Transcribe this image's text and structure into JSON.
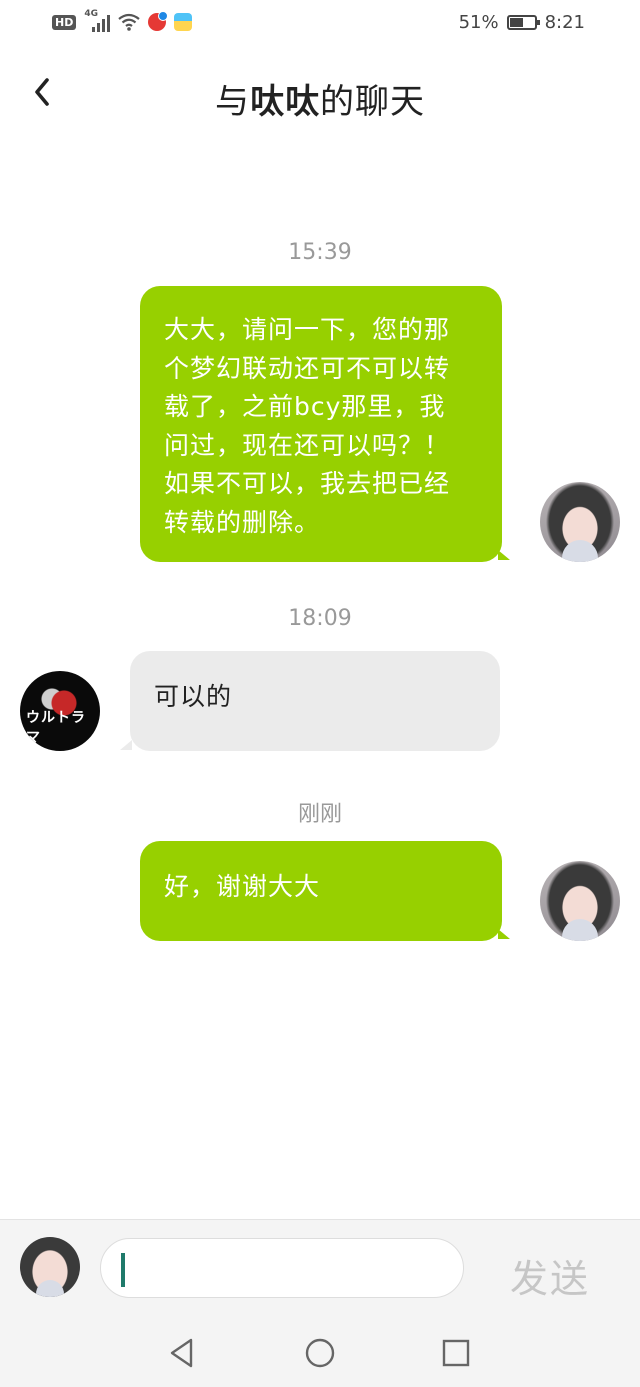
{
  "status_bar": {
    "network_label": "HD",
    "signal_label": "4G",
    "battery": "51%",
    "time": "8:21"
  },
  "header": {
    "title_prefix": "与",
    "contact_name": "呔呔",
    "title_suffix": "的聊天"
  },
  "messages": [
    {
      "time": "15:39"
    },
    {
      "text": "大大，请问一下，您的那个梦幻联动还可不可以转载了，之前bcy那里，我问过，现在还可以吗？！如果不可以，我去把已经转载的删除。",
      "direction": "out"
    },
    {
      "time": "18:09"
    },
    {
      "text": "可以的",
      "direction": "in"
    },
    {
      "time": "刚刚"
    },
    {
      "text": "好，谢谢大大",
      "direction": "out"
    }
  ],
  "message_lines": [
    "大大，请问一下，您的那",
    "个梦幻联动还可不可以转",
    "载了，之前bcy那里，我",
    "问过，现在还可以吗？！",
    "如果不可以，我去把已经",
    "转载的删除。"
  ],
  "contact_avatar_text": "ウルトラマ",
  "input": {
    "value": "",
    "send_label": "发送"
  },
  "colors": {
    "outgoing_bubble": "#97d000",
    "incoming_bubble": "#ebebeb",
    "caret": "#1f7a6b"
  }
}
